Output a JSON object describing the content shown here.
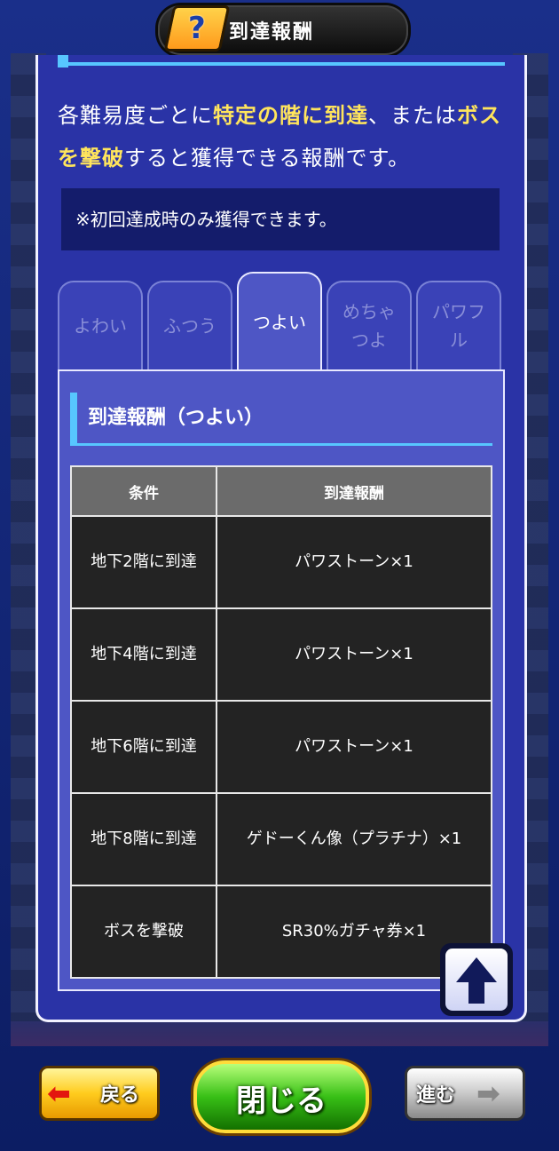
{
  "header": {
    "title": "到達報酬"
  },
  "description": {
    "part1": "各難易度ごとに",
    "highlight1": "特定の階に到達",
    "part2": "、または",
    "highlight2": "ボスを撃破",
    "part3": "すると獲得できる報酬です。"
  },
  "note": "※初回達成時のみ獲得できます。",
  "tabs": [
    {
      "label": "よわい"
    },
    {
      "label": "ふつう"
    },
    {
      "label": "つよい"
    },
    {
      "label": "めちゃつよ"
    },
    {
      "label": "パワフル"
    }
  ],
  "active_tab": "つよい",
  "section": {
    "title": "到達報酬（つよい）"
  },
  "table": {
    "headers": [
      "条件",
      "到達報酬"
    ],
    "rows": [
      {
        "condition": "地下2階に到達",
        "reward": "パワストーン×1"
      },
      {
        "condition": "地下4階に到達",
        "reward": "パワストーン×1"
      },
      {
        "condition": "地下6階に到達",
        "reward": "パワストーン×1"
      },
      {
        "condition": "地下8階に到達",
        "reward": "ゲドーくん像（プラチナ）×1"
      },
      {
        "condition": "ボスを撃破",
        "reward": "SR30%ガチャ券×1"
      }
    ]
  },
  "buttons": {
    "back": "戻る",
    "close": "閉じる",
    "next": "進む"
  },
  "icons": {
    "help": "help-question-icon",
    "scroll_top": "arrow-up-icon",
    "back_arrow": "arrow-left-icon",
    "next_arrow": "arrow-right-icon"
  },
  "colors": {
    "panel": "#2a33a6",
    "highlight": "#ffe55c",
    "accent": "#57c6ff"
  }
}
